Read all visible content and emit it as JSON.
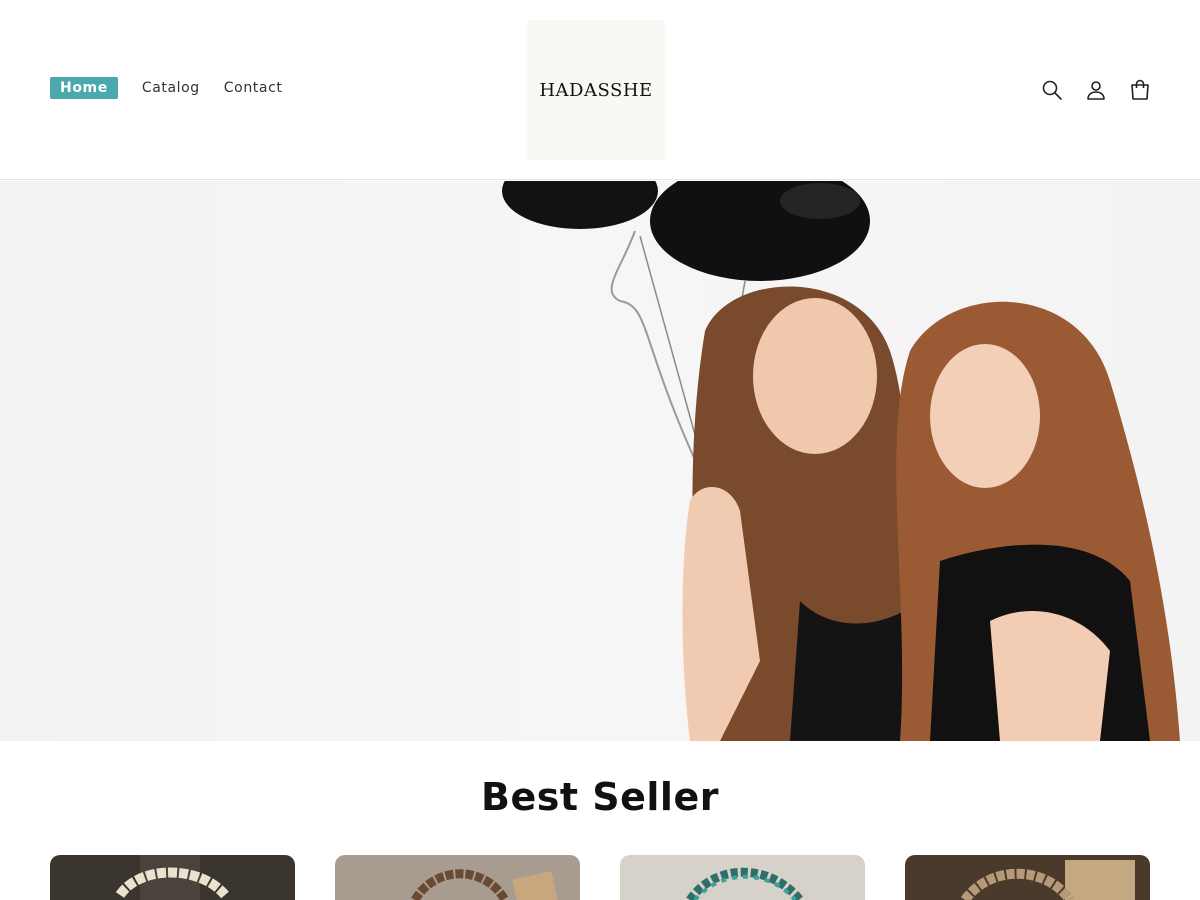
{
  "header": {
    "nav": [
      {
        "label": "Home",
        "active": true
      },
      {
        "label": "Catalog",
        "active": false
      },
      {
        "label": "Contact",
        "active": false
      }
    ],
    "logo_text": "HADASSHE",
    "icons": [
      "search-icon",
      "account-icon",
      "cart-icon"
    ]
  },
  "hero": {
    "image": "two-women-with-black-balloons"
  },
  "best_seller": {
    "title": "Best Seller",
    "products": [
      {
        "image": "cream-bead-bracelet"
      },
      {
        "image": "brown-wood-bead-bracelet"
      },
      {
        "image": "turquoise-bead-bracelet"
      },
      {
        "image": "agate-bead-bracelet"
      }
    ]
  },
  "colors": {
    "accent": "#4aa9ad",
    "text": "#111111",
    "logo_bg": "#f9f8f5"
  }
}
